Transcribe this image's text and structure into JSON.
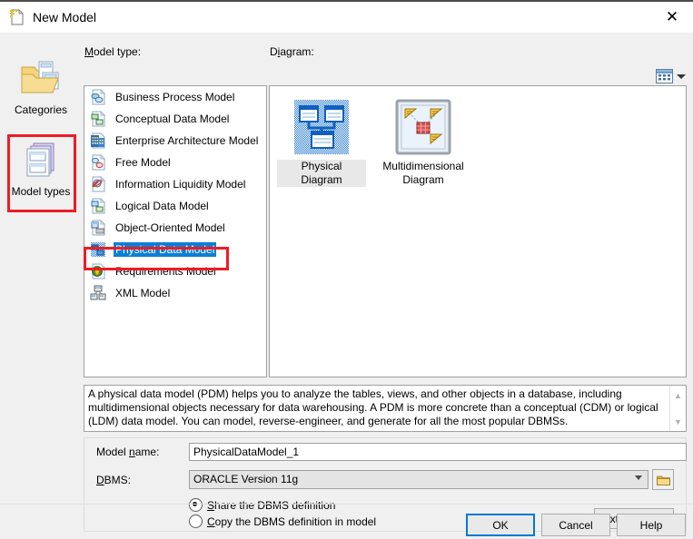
{
  "window": {
    "title": "New Model",
    "icon": "new-model-document-icon",
    "close_label": "✕"
  },
  "rail": {
    "items": [
      {
        "label": "Categories",
        "icon": "folder-models-icon",
        "selected": false
      },
      {
        "label": "Model types",
        "icon": "stacked-models-icon",
        "selected": true
      }
    ]
  },
  "labels": {
    "model_type": "Model type:",
    "diagram": "Diagram:",
    "model_name": "Model name:",
    "dbms": "DBMS:"
  },
  "model_types": {
    "items": [
      {
        "label": "Business Process Model",
        "icon": "business-process-model-icon",
        "selected": false
      },
      {
        "label": "Conceptual Data Model",
        "icon": "conceptual-data-model-icon",
        "selected": false
      },
      {
        "label": "Enterprise Architecture Model",
        "icon": "enterprise-architecture-model-icon",
        "selected": false
      },
      {
        "label": "Free Model",
        "icon": "free-model-icon",
        "selected": false
      },
      {
        "label": "Information Liquidity Model",
        "icon": "information-liquidity-model-icon",
        "selected": false
      },
      {
        "label": "Logical Data Model",
        "icon": "logical-data-model-icon",
        "selected": false
      },
      {
        "label": "Object-Oriented Model",
        "icon": "object-oriented-model-icon",
        "selected": false
      },
      {
        "label": "Physical Data Model",
        "icon": "physical-data-model-icon",
        "selected": true
      },
      {
        "label": "Requirements Model",
        "icon": "requirements-model-icon",
        "selected": false
      },
      {
        "label": "XML Model",
        "icon": "xml-model-icon",
        "selected": false
      }
    ]
  },
  "diagrams": {
    "view_toggle_icon": "view-mode-icon",
    "items": [
      {
        "label": "Physical Diagram",
        "icon": "physical-diagram-icon",
        "selected": true
      },
      {
        "label": "Multidimensional Diagram",
        "icon": "multidimensional-diagram-icon",
        "selected": false
      }
    ]
  },
  "description": {
    "text": "A physical data model (PDM) helps you to analyze the tables, views, and other objects in a database, including multidimensional objects necessary for data warehousing. A PDM is more concrete than a conceptual (CDM) or logical (LDM) data model. You can model, reverse-engineer, and generate for all the most popular DBMSs.",
    "scroll_up_icon": "scroll-up-arrow",
    "scroll_down_icon": "scroll-down-arrow"
  },
  "form": {
    "model_name_value": "PhysicalDataModel_1",
    "model_name_placeholder": "",
    "dbms_value": "ORACLE Version 11g",
    "dbms_browse_icon": "folder-browse-icon",
    "radios": [
      {
        "label": "Share the DBMS definition",
        "checked": true
      },
      {
        "label": "Copy the DBMS definition in model",
        "checked": false
      }
    ],
    "extensions_label": "Extensions..."
  },
  "footer": {
    "ok": "OK",
    "cancel": "Cancel",
    "help": "Help"
  },
  "colors": {
    "selection_blue": "#0c7fd4",
    "highlight_red": "#ed1c24",
    "default_button_focus": "#0078d7",
    "dialog_bg": "#f0f0f0"
  }
}
